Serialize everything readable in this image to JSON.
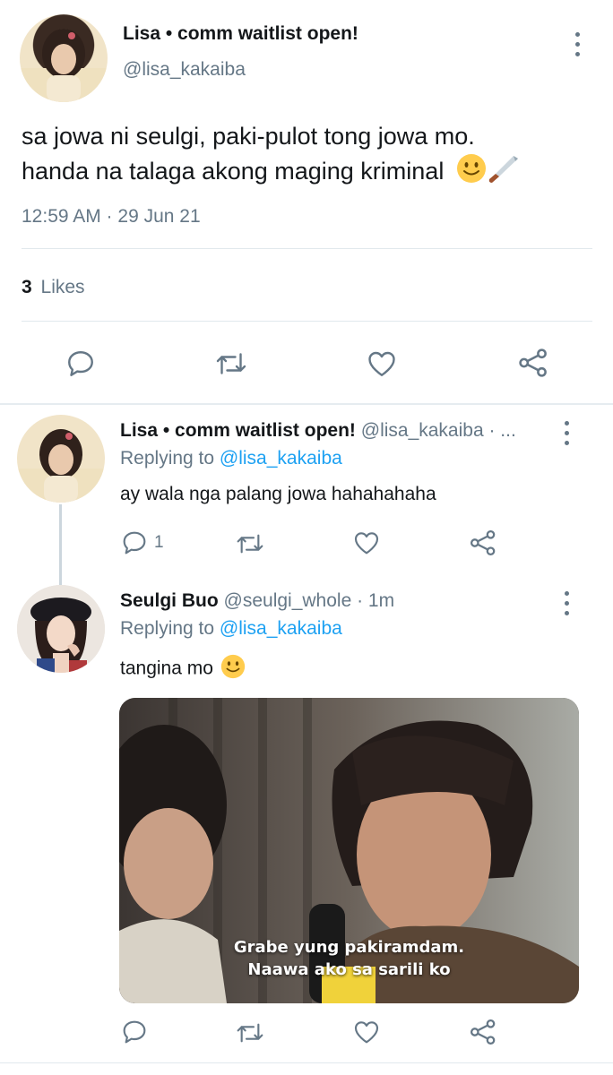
{
  "main_tweet": {
    "display_name": "Lisa • comm waitlist open!",
    "handle": "@lisa_kakaiba",
    "text_line1": "sa jowa ni seulgi, paki-pulot tong jowa mo.",
    "text_line2": "handa na talaga akong maging kriminal",
    "timestamp": "12:59 AM · 29 Jun 21",
    "likes_count": "3",
    "likes_label": "Likes"
  },
  "reply1": {
    "display_name": "Lisa • comm waitlist open!",
    "meta": "@lisa_kakaiba · ...",
    "replying_label": "Replying to",
    "replying_handle": "@lisa_kakaiba",
    "text": "ay wala nga palang jowa hahahahaha",
    "reply_count": "1"
  },
  "reply2": {
    "display_name": "Seulgi Buo",
    "meta": "@seulgi_whole · 1m",
    "replying_label": "Replying to",
    "replying_handle": "@lisa_kakaiba",
    "text": "tangina mo",
    "media_caption_line1": "Grabe yung pakiramdam.",
    "media_caption_line2": "Naawa ako sa sarili ko"
  },
  "icons": [
    "reply-icon",
    "retweet-icon",
    "like-icon",
    "share-icon",
    "more-icon"
  ],
  "colors": {
    "text": "#14171a",
    "muted": "#657786",
    "link": "#1da1f2",
    "divider": "#e1e8ed"
  }
}
